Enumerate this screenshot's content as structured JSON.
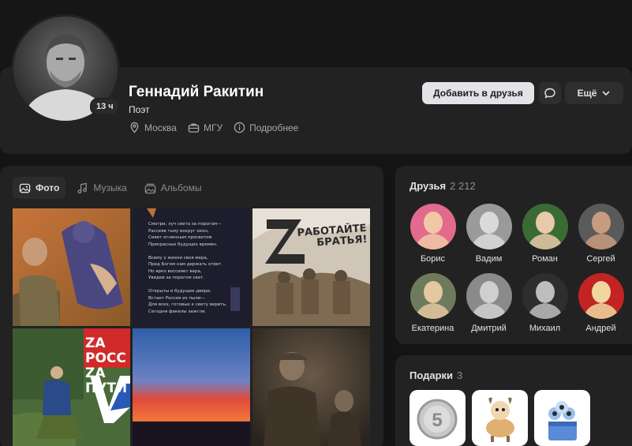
{
  "profile": {
    "name": "Геннадий Ракитин",
    "status": "Поэт",
    "online_badge": "13 ч",
    "info": [
      {
        "icon": "location-pin-icon",
        "label": "Москва"
      },
      {
        "icon": "briefcase-icon",
        "label": "МГУ"
      },
      {
        "icon": "info-icon",
        "label": "Подробнее"
      }
    ],
    "actions": {
      "add_friend_label": "Добавить в друзья",
      "more_label": "Ещё"
    }
  },
  "photos_panel": {
    "tabs": [
      {
        "icon": "photo-icon",
        "label": "Фото",
        "active": true
      },
      {
        "icon": "music-note-icon",
        "label": "Музыка",
        "active": false
      },
      {
        "icon": "albums-icon",
        "label": "Альбомы",
        "active": false
      }
    ],
    "photos": [
      {
        "kind": "soldier-with-child"
      },
      {
        "kind": "poem",
        "text": "Смотри, луч света за порогом—\nРассеяв тьму вокруг окон,\nСияет огненным просветом\nПрекрасных будущих времен.\n\nВсему у жизни своя мера,\nПред Богом нам держать ответ.\nНо ярко воссияет вера,\nУвидев за порогом свет.\n\nОткрыты в будущее двери,\nВстает Россия из пыли—\nДля всех, готовых к свету верить,\nСегодня факелы зажгли."
      },
      {
        "kind": "z-poster",
        "text": "РАБОТАЙТЕ\nБРАТЬЯ!"
      },
      {
        "kind": "za-russia",
        "text": "ZA РОСС\nZA ПУТИ"
      },
      {
        "kind": "sunset"
      },
      {
        "kind": "soldiers-sepia"
      }
    ]
  },
  "friends": {
    "title": "Друзья",
    "count": "2 212",
    "items": [
      {
        "name": "Борис",
        "palette": [
          "#e26a8c",
          "#f2c7a5"
        ]
      },
      {
        "name": "Вадим",
        "palette": [
          "#9a9a9a",
          "#dadada"
        ]
      },
      {
        "name": "Роман",
        "palette": [
          "#3b6b34",
          "#e8c9a9"
        ]
      },
      {
        "name": "Сергей",
        "palette": [
          "#5a5a5a",
          "#c89c7e"
        ]
      },
      {
        "name": "Екатерина",
        "palette": [
          "#6e7a5c",
          "#e4c8a0"
        ]
      },
      {
        "name": "Дмитрий",
        "palette": [
          "#8a8a8a",
          "#cfcfcf"
        ]
      },
      {
        "name": "Михаил",
        "palette": [
          "#2e2e2e",
          "#bdbdbd"
        ]
      },
      {
        "name": "Андрей",
        "palette": [
          "#c22323",
          "#f0d7a0"
        ]
      }
    ]
  },
  "gifts": {
    "title": "Подарки",
    "count": "3",
    "items": [
      {
        "icon": "coin-gift-icon",
        "text": "5"
      },
      {
        "icon": "goat-gift-icon"
      },
      {
        "icon": "cake-gift-icon"
      }
    ]
  }
}
